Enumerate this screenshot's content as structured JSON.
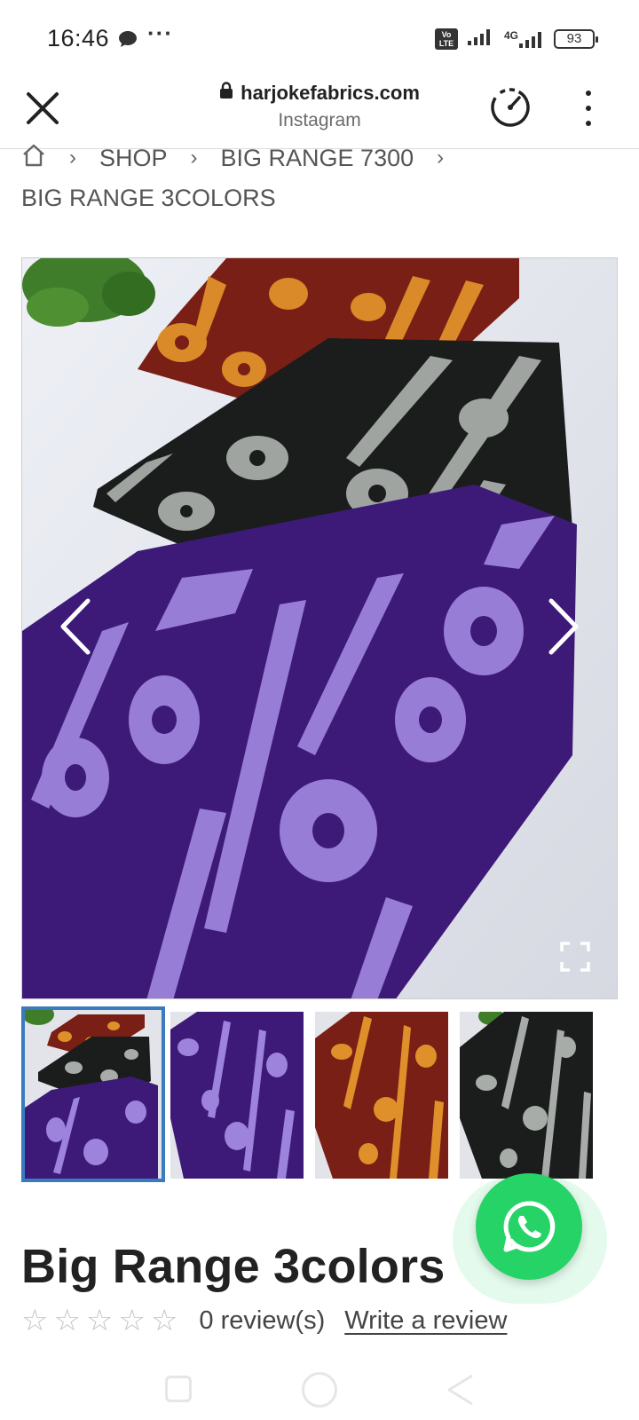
{
  "status_bar": {
    "time": "16:46",
    "dots": "···",
    "volte_label": "Vo LTE",
    "network_label": "4G",
    "battery_level": "93",
    "icons": [
      "chat-bubble-icon",
      "volte-icon",
      "signal-icon",
      "4g-signal-icon",
      "battery-icon"
    ]
  },
  "browser": {
    "domain": "harjokefabrics.com",
    "source": "Instagram",
    "icons": [
      "close-icon",
      "lock-icon",
      "speedometer-icon",
      "more-vert-icon"
    ]
  },
  "breadcrumb": {
    "items": [
      "SHOP",
      "BIG RANGE 7300"
    ],
    "current": "BIG RANGE 3COLORS",
    "icons": [
      "home-icon",
      "chevron-right-icon"
    ]
  },
  "gallery": {
    "main_image": "Three folded batik fabrics stacked: maroon/orange, black/grey, purple/lavender",
    "thumbnail_count": 4,
    "active_thumbnail": 1,
    "thumbnail_colors": [
      "mixed",
      "purple",
      "maroon-orange",
      "black-grey"
    ],
    "icons": [
      "chevron-left-icon",
      "chevron-right-icon",
      "fullscreen-icon"
    ]
  },
  "product": {
    "title": "Big Range 3colors",
    "rating": 0,
    "max_rating": 5,
    "review_count_label": "0 review(s)",
    "write_review_label": "Write a review"
  },
  "colors": {
    "accent_blue": "#3a7bc0",
    "whatsapp_green": "#25d366",
    "maroon": "#7a1f15",
    "orange": "#e0902a",
    "black_fabric": "#1a1d1c",
    "grey": "#a8aca9",
    "purple": "#3e1a78",
    "lavender": "#9d83dc"
  }
}
